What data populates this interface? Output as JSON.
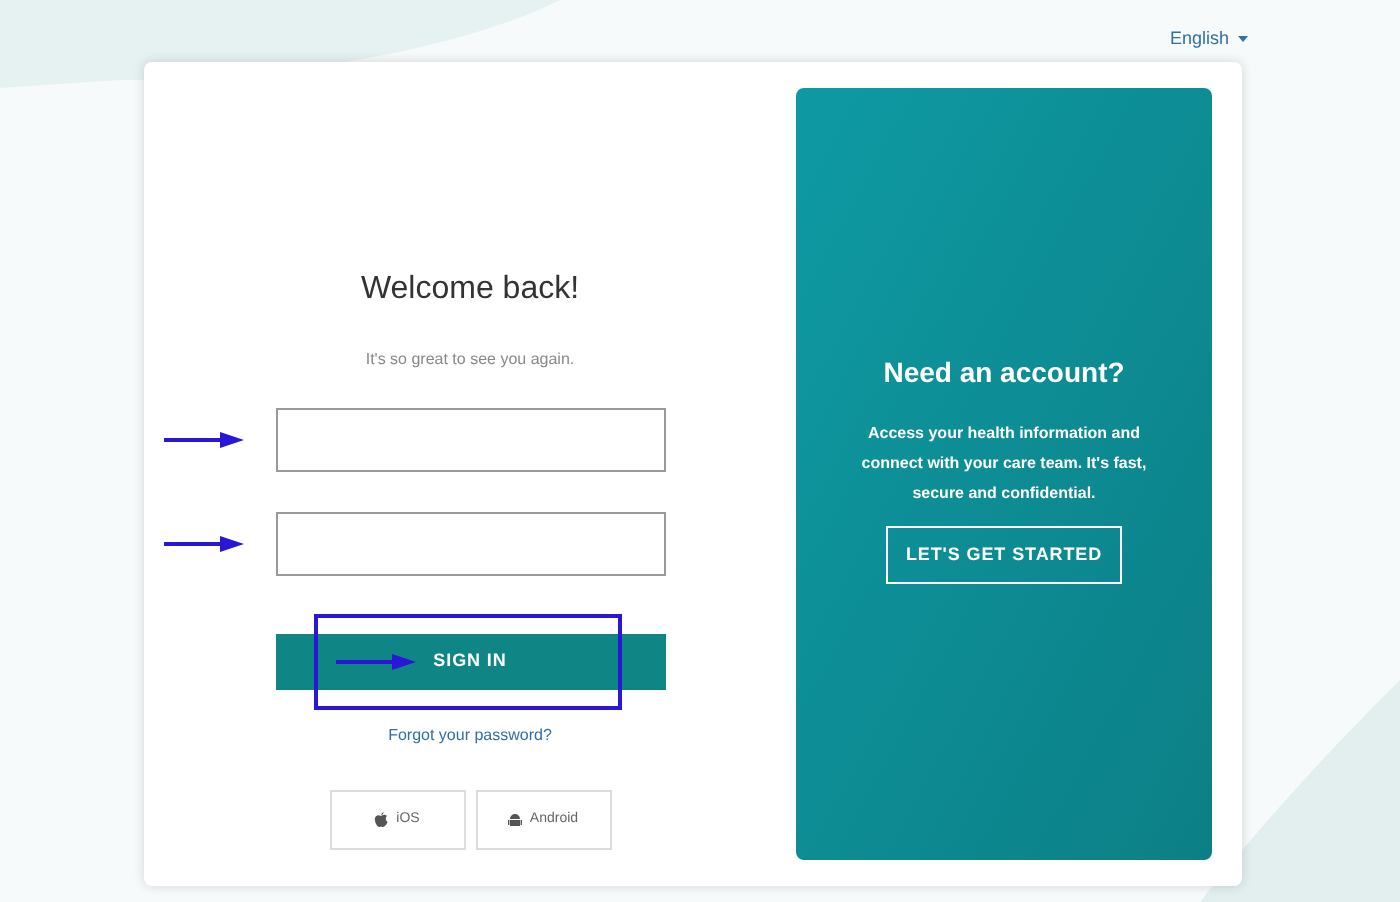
{
  "language": {
    "label": "English"
  },
  "sign_in": {
    "title": "Welcome back!",
    "subtitle": "It's so great to see you again.",
    "fields": [
      {
        "annotated": true
      },
      {
        "annotated": true
      }
    ],
    "button": {
      "label": "SIGN IN",
      "annotated": true
    },
    "forgot_link": "Forgot your password?",
    "app_buttons": [
      {
        "kind": "apple",
        "label": "iOS"
      },
      {
        "kind": "android",
        "label": "Android"
      }
    ]
  },
  "signup_panel": {
    "title": "Need an account?",
    "text": "Access your health information and connect with your care team. It's fast, secure and confidential.",
    "button": "LET'S GET STARTED"
  }
}
